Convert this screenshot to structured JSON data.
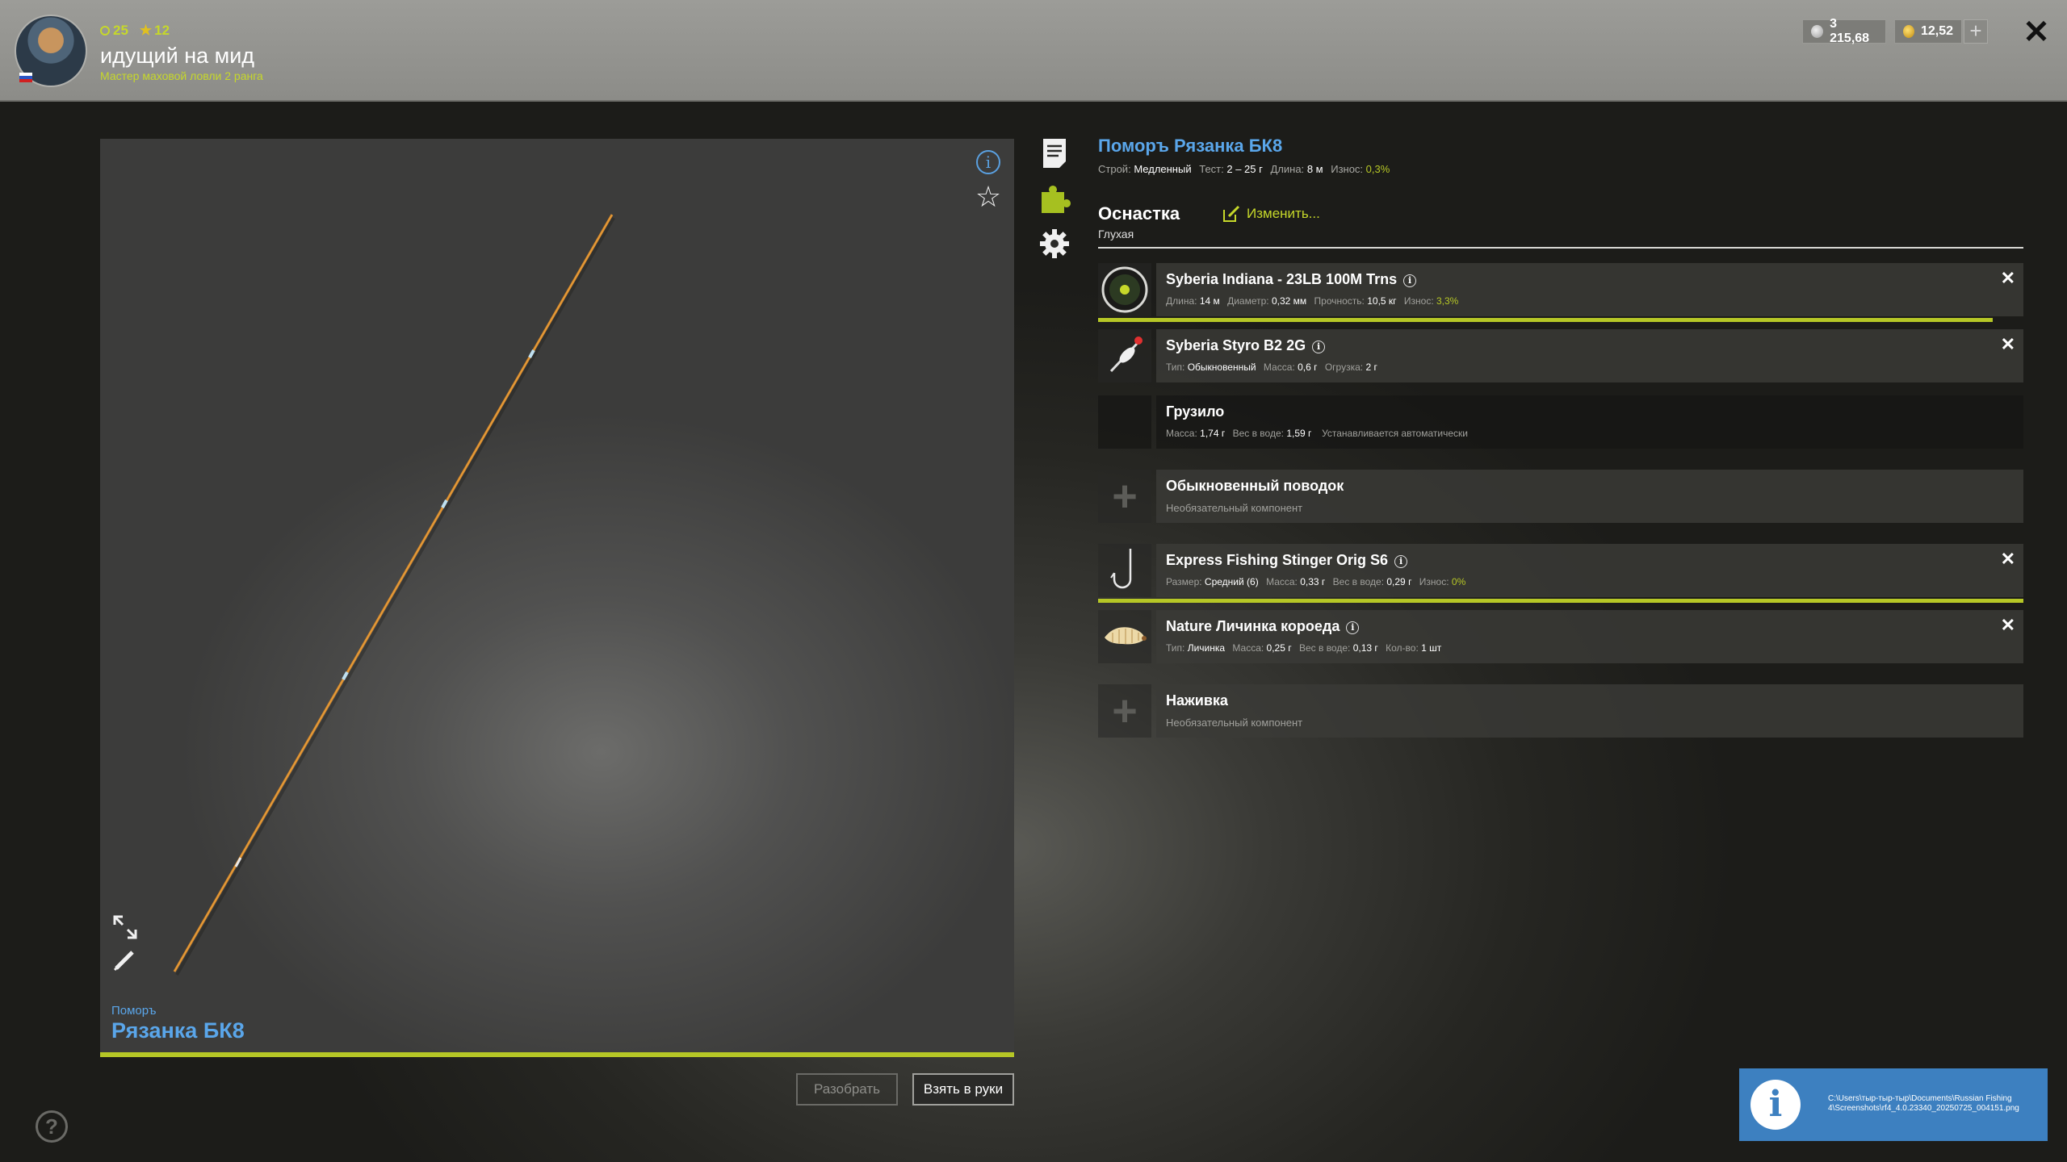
{
  "header": {
    "level": "25",
    "stars": "12",
    "player_name": "идущий на  мид",
    "player_title": "Мастер маховой ловли 2 ранга",
    "silver": "3 215,68",
    "gold": "12,52",
    "plus_label": "+",
    "close_label": "✕"
  },
  "preview": {
    "brand": "Поморъ",
    "rod_name": "Рязанка БК8",
    "info_label": "i",
    "fav_label": "☆"
  },
  "buttons": {
    "disassemble": "Разобрать",
    "take": "Взять в руки"
  },
  "rod": {
    "title": "Поморъ Рязанка БК8",
    "action_label": "Строй:",
    "action": "Медленный",
    "test_label": "Тест:",
    "test": "2 – 25 г",
    "length_label": "Длина:",
    "length": "8 м",
    "wear_label": "Износ:",
    "wear": "0,3%"
  },
  "rig": {
    "title": "Оснастка",
    "type": "Глухая",
    "change_label": "Изменить..."
  },
  "slots": {
    "line": {
      "name": "Syberia Indiana - 23LB 100M Trns",
      "s1l": "Длина:",
      "s1": "14 м",
      "s2l": "Диаметр:",
      "s2": "0,32 мм",
      "s3l": "Прочность:",
      "s3": "10,5 кг",
      "s4l": "Износ:",
      "s4": "3,3%",
      "wear_fraction": 0.967
    },
    "float": {
      "name": "Syberia Styro B2 2G",
      "s1l": "Тип:",
      "s1": "Обыкновенный",
      "s2l": "Масса:",
      "s2": "0,6 г",
      "s3l": "Огрузка:",
      "s3": "2 г"
    },
    "sinker": {
      "name": "Грузило",
      "s1l": "Масса:",
      "s1": "1,74 г",
      "s2l": "Вес в воде:",
      "s2": "1,59 г",
      "s3": "Устанавливается автоматически"
    },
    "leader": {
      "name": "Обыкновенный поводок",
      "sub": "Необязательный компонент"
    },
    "hook": {
      "name": "Express Fishing Stinger Orig S6",
      "s1l": "Размер:",
      "s1": "Средний (6)",
      "s2l": "Масса:",
      "s2": "0,33 г",
      "s3l": "Вес в воде:",
      "s3": "0,29 г",
      "s4l": "Износ:",
      "s4": "0%",
      "wear_fraction": 1.0
    },
    "bait": {
      "name": "Nature Личинка короеда",
      "s1l": "Тип:",
      "s1": "Личинка",
      "s2l": "Масса:",
      "s2": "0,25 г",
      "s3l": "Вес в воде:",
      "s3": "0,13 г",
      "s4l": "Кол-во:",
      "s4": "1 шт"
    },
    "groundbait": {
      "name": "Наживка",
      "sub": "Необязательный компонент"
    }
  },
  "toast": {
    "path": "C:\\Users\\тыр-тыр-тыр\\Documents\\Russian Fishing 4\\Screenshots\\rf4_4.0.23340_20250725_004151.png",
    "icon_label": "i"
  },
  "help_label": "?",
  "colors": {
    "accent_green": "#b6c726",
    "accent_blue": "#5aa6ea",
    "toast_blue": "#3d80c0"
  }
}
